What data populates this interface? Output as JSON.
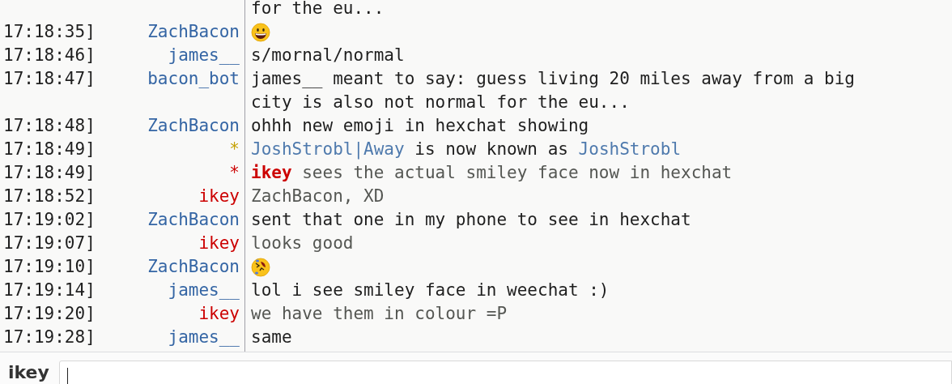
{
  "chat_lines": [
    {
      "kind": "continuation",
      "parts": [
        {
          "kind": "plain",
          "text": "for the eu..."
        }
      ]
    },
    {
      "kind": "grin",
      "time": "17:18:35]",
      "nick": "ZachBacon",
      "color": "#3465a4"
    },
    {
      "kind": "message",
      "time": "17:18:46]",
      "nick": "james__",
      "color": "#3465a4",
      "parts": [
        {
          "kind": "plain",
          "text": "s/mornal/normal"
        }
      ]
    },
    {
      "kind": "message",
      "time": "17:18:47]",
      "nick": "bacon_bot",
      "color": "#3465a4",
      "parts": [
        {
          "kind": "plain",
          "text": "james__ meant to say: guess living 20 miles away from a big city is also not normal for the eu..."
        }
      ]
    },
    {
      "kind": "message",
      "time": "17:18:48]",
      "nick": "ZachBacon",
      "color": "#3465a4",
      "parts": [
        {
          "kind": "plain",
          "text": "ohhh new emoji in hexchat showing"
        }
      ]
    },
    {
      "kind": "message",
      "time": "17:18:49]",
      "nick": "*",
      "color": "#c4a000",
      "parts": [
        {
          "kind": "nick",
          "text": "JoshStrobl|Away"
        },
        {
          "kind": "plain",
          "text": " is now known as "
        },
        {
          "kind": "nick",
          "text": "JoshStrobl"
        }
      ]
    },
    {
      "kind": "message",
      "time": "17:18:49]",
      "nick": "*",
      "color": "#cc0000",
      "parts": [
        {
          "kind": "own_nick",
          "text": "ikey"
        },
        {
          "kind": "own",
          "text": " sees the actual smiley face now in hexchat"
        }
      ]
    },
    {
      "kind": "message",
      "time": "17:18:52]",
      "nick": "ikey",
      "color": "#cc0000",
      "parts": [
        {
          "kind": "own",
          "text": "ZachBacon, XD"
        }
      ]
    },
    {
      "kind": "message",
      "time": "17:19:02]",
      "nick": "ZachBacon",
      "color": "#3465a4",
      "parts": [
        {
          "kind": "plain",
          "text": "sent that one in my phone to see in hexchat"
        }
      ]
    },
    {
      "kind": "message",
      "time": "17:19:07]",
      "nick": "ikey",
      "color": "#cc0000",
      "parts": [
        {
          "kind": "own",
          "text": "looks good"
        }
      ]
    },
    {
      "kind": "rofl",
      "time": "17:19:10]",
      "nick": "ZachBacon",
      "color": "#3465a4"
    },
    {
      "kind": "message",
      "time": "17:19:14]",
      "nick": "james__",
      "color": "#3465a4",
      "parts": [
        {
          "kind": "plain",
          "text": "lol i see smiley face in weechat :)"
        }
      ]
    },
    {
      "kind": "message",
      "time": "17:19:20]",
      "nick": "ikey",
      "color": "#cc0000",
      "parts": [
        {
          "kind": "own",
          "text": "we have them in colour =P"
        }
      ]
    },
    {
      "kind": "message",
      "time": "17:19:28]",
      "nick": "james__",
      "color": "#3465a4",
      "parts": [
        {
          "kind": "plain",
          "text": "same"
        }
      ]
    }
  ],
  "input": {
    "nick": "ikey"
  }
}
